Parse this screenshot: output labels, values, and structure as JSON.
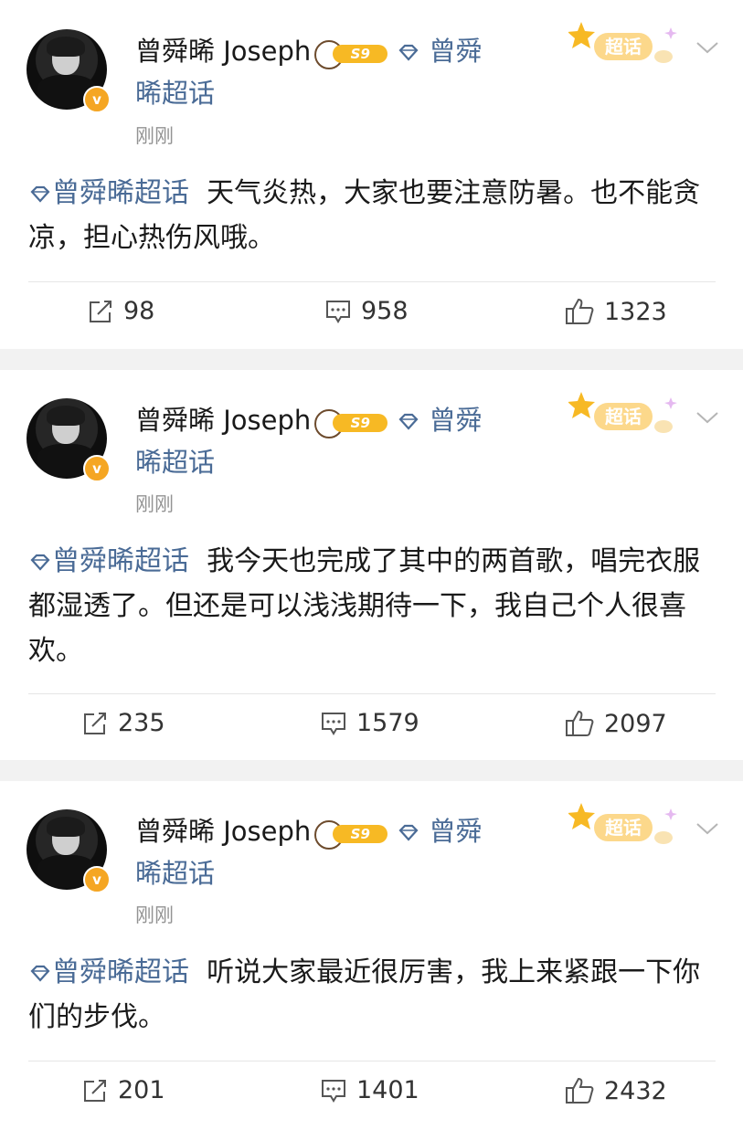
{
  "posts": [
    {
      "author": "曾舜晞 Joseph",
      "level": "S9",
      "topic_first": "曾舜",
      "topic_second": "晞超话",
      "super_badge": "超话",
      "time": "刚刚",
      "tag": "曾舜晞超话",
      "text": "天气炎热，大家也要注意防暑。也不能贪凉，担心热伤风哦。",
      "reposts": "98",
      "comments": "958",
      "likes": "1323"
    },
    {
      "author": "曾舜晞 Joseph",
      "level": "S9",
      "topic_first": "曾舜",
      "topic_second": "晞超话",
      "super_badge": "超话",
      "time": "刚刚",
      "tag": "曾舜晞超话",
      "text": "我今天也完成了其中的两首歌，唱完衣服都湿透了。但还是可以浅浅期待一下，我自己个人很喜欢。",
      "reposts": "235",
      "comments": "1579",
      "likes": "2097"
    },
    {
      "author": "曾舜晞 Joseph",
      "level": "S9",
      "topic_first": "曾舜",
      "topic_second": "晞超话",
      "super_badge": "超话",
      "time": "刚刚",
      "tag": "曾舜晞超话",
      "text": "听说大家最近很厉害，我上来紧跟一下你们的步伐。",
      "reposts": "201",
      "comments": "1401",
      "likes": "2432"
    }
  ],
  "colors": {
    "link_blue": "#4a6b96",
    "level_gold": "#f7b924",
    "verified_orange": "#f5a623",
    "meta_gray": "#939393"
  },
  "icons": {
    "repost": "repost-icon",
    "comment": "comment-icon",
    "like": "thumbs-up-icon",
    "topic": "diamond-icon",
    "more": "chevron-down-icon"
  }
}
